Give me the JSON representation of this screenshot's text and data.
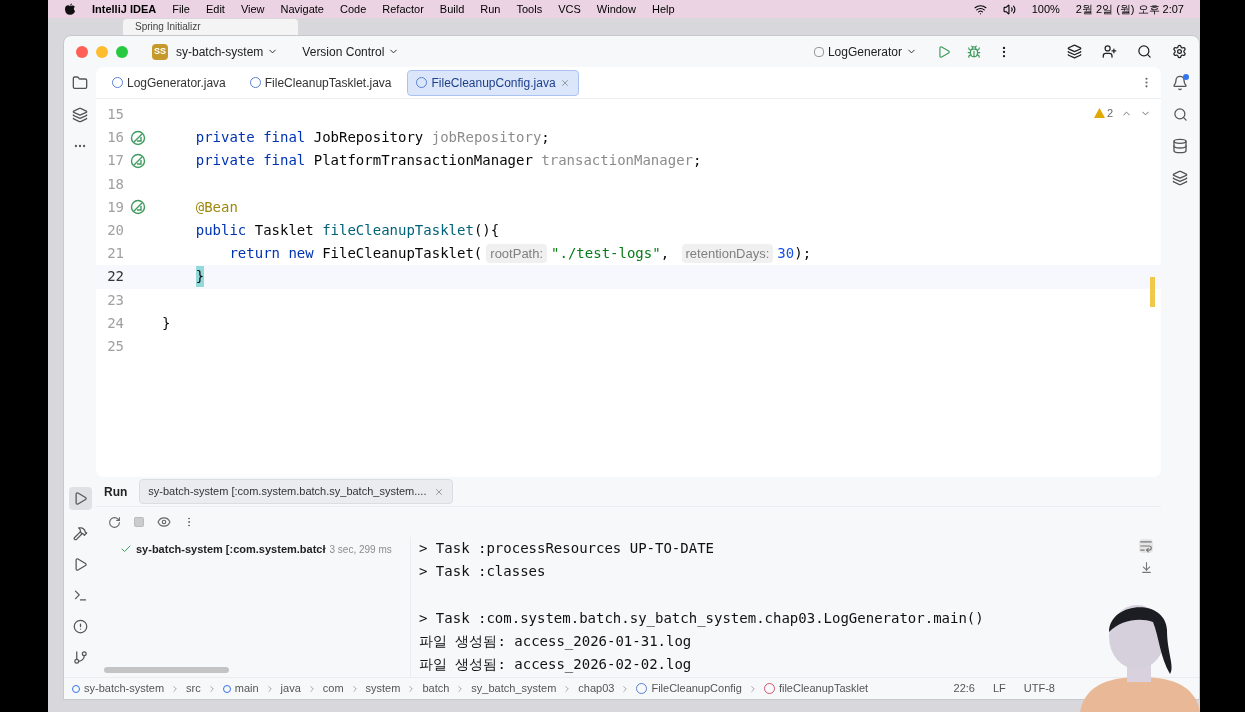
{
  "menubar": {
    "app": "IntelliJ IDEA",
    "items": [
      "File",
      "Edit",
      "View",
      "Navigate",
      "Code",
      "Refactor",
      "Build",
      "Run",
      "Tools",
      "VCS",
      "Window",
      "Help"
    ],
    "battery": "100%",
    "clock": "2월 2일 (월) 오후 2:07"
  },
  "browser_tab": {
    "title": "Spring Initializr"
  },
  "titlebar": {
    "project_badge": "SS",
    "project": "sy-batch-system",
    "vcs": "Version Control",
    "run_config": "LogGenerator"
  },
  "tabs": [
    {
      "label": "LogGenerator.java",
      "selected": false
    },
    {
      "label": "FileCleanupTasklet.java",
      "selected": false
    },
    {
      "label": "FileCleanupConfig.java",
      "selected": true
    }
  ],
  "inspections": {
    "warnings": "2"
  },
  "code": [
    {
      "number": "15",
      "current": false,
      "gutter": false
    },
    {
      "number": "16",
      "current": false,
      "gutter": true,
      "tokens": [
        {
          "kind": "keyword",
          "text": "    private final "
        },
        {
          "kind": "plain",
          "text": "JobRepository "
        },
        {
          "kind": "unused",
          "text": "jobRepository"
        },
        {
          "kind": "plain",
          "text": ";"
        }
      ]
    },
    {
      "number": "17",
      "current": false,
      "gutter": true,
      "tokens": [
        {
          "kind": "keyword",
          "text": "    private final "
        },
        {
          "kind": "plain",
          "text": "PlatformTransactionManager "
        },
        {
          "kind": "unused",
          "text": "transactionManager"
        },
        {
          "kind": "plain",
          "text": ";"
        }
      ]
    },
    {
      "number": "18",
      "current": false,
      "gutter": false
    },
    {
      "number": "19",
      "current": false,
      "gutter": true,
      "tokens": [
        {
          "kind": "annotation",
          "text": "    @Bean"
        }
      ]
    },
    {
      "number": "20",
      "current": false,
      "gutter": false,
      "tokens": [
        {
          "kind": "keyword",
          "text": "    public "
        },
        {
          "kind": "plain",
          "text": "Tasklet "
        },
        {
          "kind": "method",
          "text": "fileCleanupTasklet"
        },
        {
          "kind": "plain",
          "text": "(){"
        }
      ]
    },
    {
      "number": "21",
      "current": false,
      "gutter": false,
      "tokens": [
        {
          "kind": "keyword",
          "text": "        return new "
        },
        {
          "kind": "plain",
          "text": "FileCleanupTasklet("
        },
        {
          "kind": "hint",
          "text": "rootPath:"
        },
        {
          "kind": "string",
          "text": "\"./test-logs\""
        },
        {
          "kind": "plain",
          "text": ", "
        },
        {
          "kind": "hint",
          "text": "retentionDays:"
        },
        {
          "kind": "number",
          "text": "30"
        },
        {
          "kind": "plain",
          "text": ");"
        }
      ]
    },
    {
      "number": "22",
      "current": true,
      "gutter": false,
      "tokens": [
        {
          "kind": "brace",
          "text": "    }"
        }
      ]
    },
    {
      "number": "23",
      "current": false,
      "gutter": false
    },
    {
      "number": "24",
      "current": false,
      "gutter": false,
      "tokens": [
        {
          "kind": "plain",
          "text": "}"
        }
      ]
    },
    {
      "number": "25",
      "current": false,
      "gutter": false
    }
  ],
  "run": {
    "title": "Run",
    "tab": "sy-batch-system [:com.system.batch.sy_batch_system....",
    "tree_item": {
      "label": "sy-batch-system [:com.system.batcł",
      "time": "3 sec, 299 ms"
    },
    "console": [
      [
        "> Task :processResources UP-TO-DATE",
        "> Task :classes"
      ],
      [
        "> Task :com.system.batch.sy_batch_system.chap03.LogGenerator.main()",
        "파일 생성됨: access_2026-01-31.log",
        "파일 생성됨: access_2026-02-02.log"
      ]
    ]
  },
  "breadcrumbs": [
    {
      "kind": "module",
      "text": "sy-batch-system"
    },
    {
      "kind": "folder",
      "text": "src"
    },
    {
      "kind": "module",
      "text": "main"
    },
    {
      "kind": "folder",
      "text": "java"
    },
    {
      "kind": "folder",
      "text": "com"
    },
    {
      "kind": "folder",
      "text": "system"
    },
    {
      "kind": "folder",
      "text": "batch"
    },
    {
      "kind": "folder",
      "text": "sy_batch_system"
    },
    {
      "kind": "folder",
      "text": "chap03"
    },
    {
      "kind": "class",
      "text": "FileCleanupConfig"
    },
    {
      "kind": "method",
      "text": "fileCleanupTasklet"
    }
  ],
  "status": [
    "22:6",
    "LF",
    "UTF-8"
  ],
  "webcam": {
    "kind": "picture"
  }
}
